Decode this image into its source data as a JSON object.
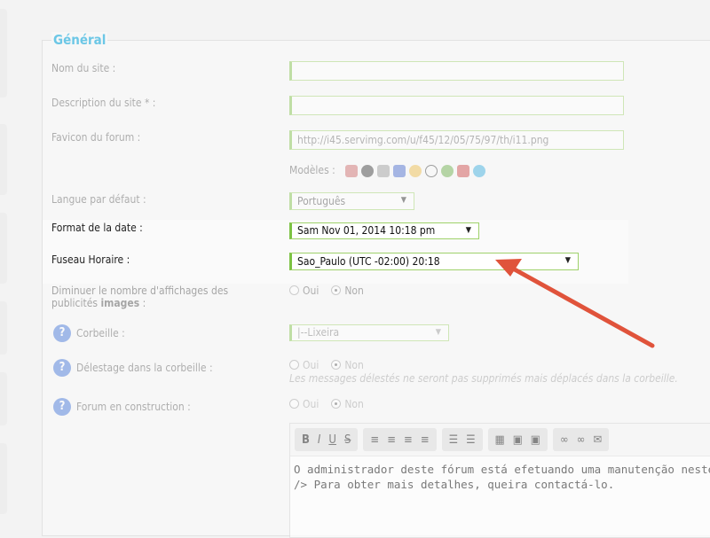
{
  "section": {
    "title": "Général"
  },
  "fields": {
    "site_name": {
      "label": "Nom du site :",
      "value": ""
    },
    "site_description": {
      "label": "Description du site * :",
      "value": ""
    },
    "favicon": {
      "label": "Favicon du forum :",
      "value": "http://i45.servimg.com/u/f45/12/05/75/97/th/i11.png"
    },
    "models": {
      "label": "Modèles :",
      "icons": [
        "books-icon",
        "spiral-icon",
        "pattern-icon",
        "monitor-icon",
        "smiley-icon",
        "speech-bubble-icon",
        "globe-icon",
        "notepad-icon",
        "chat-bubbles-icon"
      ]
    },
    "language": {
      "label": "Langue par défaut :",
      "value": "Português"
    },
    "date_format": {
      "label": "Format de la date :",
      "value": "Sam Nov 01, 2014 10:18 pm"
    },
    "timezone": {
      "label": "Fuseau Horaire :",
      "value": "Sao_Paulo (UTC -02:00) 20:18"
    },
    "reduce_ads": {
      "label": "Diminuer le nombre d'affichages des publicités",
      "label_bold": "images",
      "label_end": " :",
      "options": [
        "Oui",
        "Non"
      ],
      "selected": "Non"
    },
    "trash": {
      "label": "Corbeille :",
      "value": "|--Lixeira"
    },
    "trash_offload": {
      "label": "Délestage dans la corbeille :",
      "options": [
        "Oui",
        "Non"
      ],
      "selected": "Non",
      "note": "Les messages délestés ne seront pas supprimés mais déplacés dans la corbeille."
    },
    "construction": {
      "label": "Forum en construction :",
      "options": [
        "Oui",
        "Non"
      ],
      "selected": "Non"
    }
  },
  "editor": {
    "toolbar": [
      "B",
      "I",
      "U",
      "S"
    ],
    "text_line1": "O administrador deste fórum está efetuando uma manutenção neste mo",
    "text_line2": "/> Para obter mais detalhes, queira contactá-lo."
  },
  "colors": {
    "accent": "#7cc243",
    "arrow": "#e0533b",
    "title": "#6cc7e6"
  }
}
